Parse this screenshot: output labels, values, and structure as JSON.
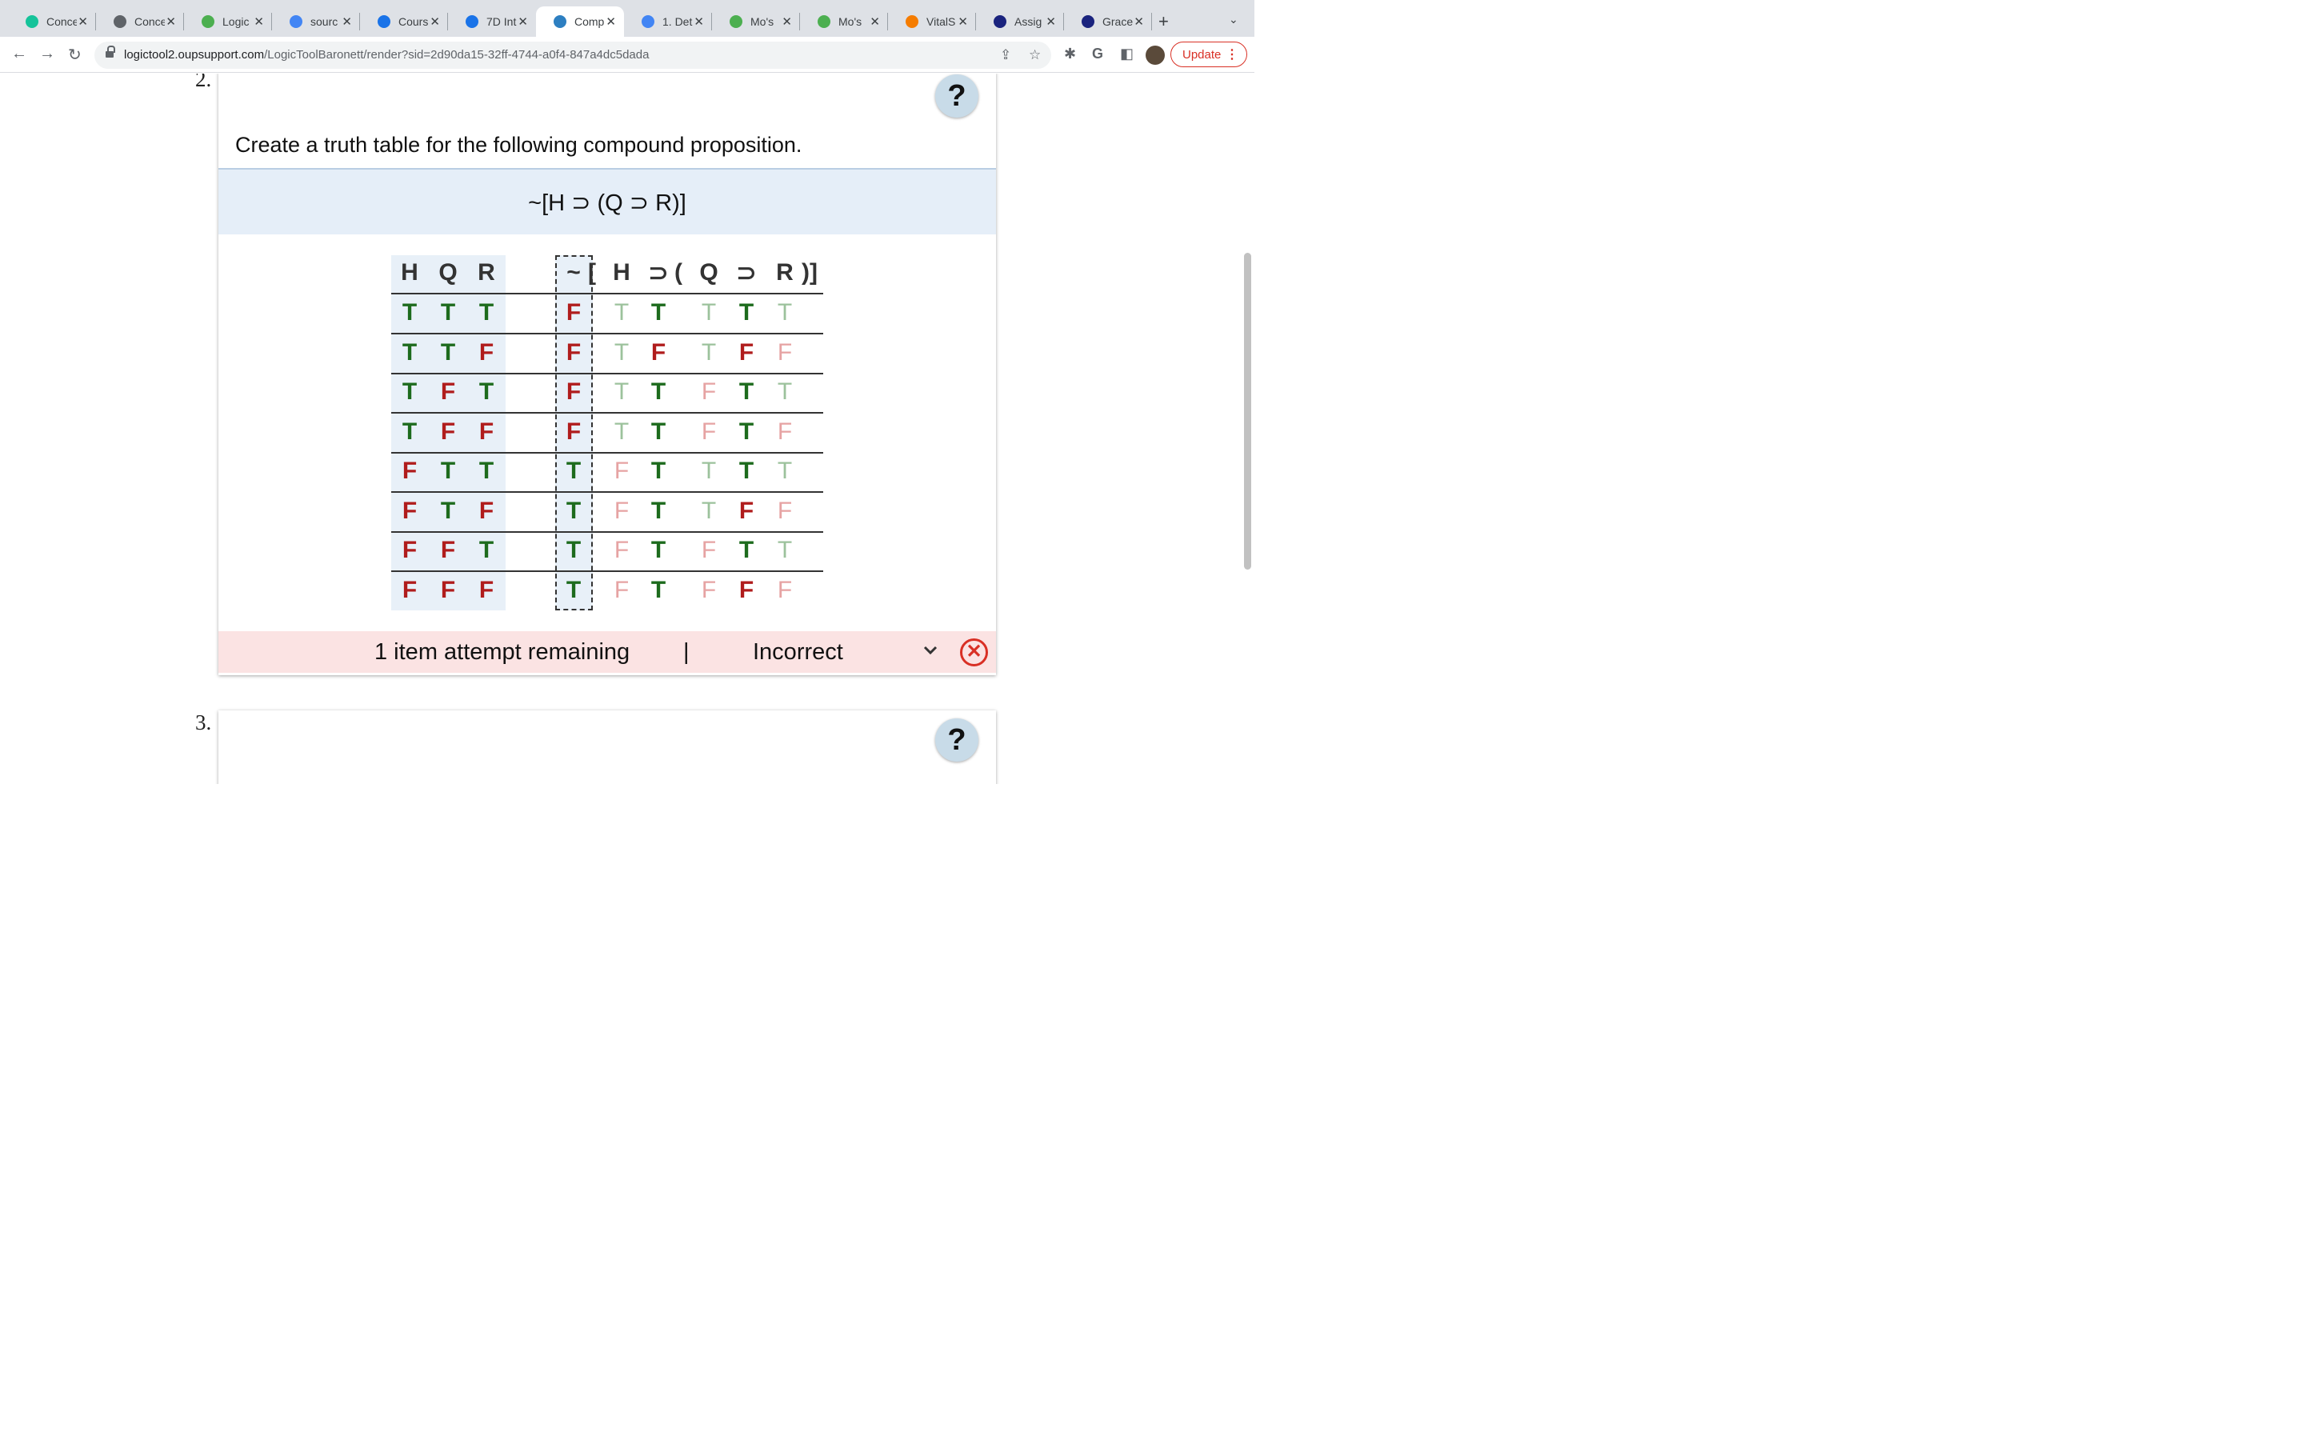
{
  "browser": {
    "tabs": [
      {
        "label": "Conce",
        "icon": "grammarly-icon",
        "color": "#15c39a"
      },
      {
        "label": "Conce",
        "icon": "globe-icon",
        "color": "#5f6368"
      },
      {
        "label": "Logic",
        "icon": "asterisk-icon",
        "color": "#4caf50"
      },
      {
        "label": "sourc",
        "icon": "docs-icon",
        "color": "#4285f4"
      },
      {
        "label": "Cours",
        "icon": "circle-icon",
        "color": "#1a73e8"
      },
      {
        "label": "7D Int",
        "icon": "circle-icon",
        "color": "#1a73e8"
      },
      {
        "label": "Comp",
        "icon": "oup-logic-icon",
        "color": "#2d7fc1"
      },
      {
        "label": "1. Det",
        "icon": "google-icon",
        "color": "#4285f4"
      },
      {
        "label": "Mo's",
        "icon": "asterisk-icon",
        "color": "#4caf50"
      },
      {
        "label": "Mo's",
        "icon": "asterisk-icon",
        "color": "#4caf50"
      },
      {
        "label": "VitalS",
        "icon": "vitalsource-icon",
        "color": "#f57c00"
      },
      {
        "label": "Assig",
        "icon": "bookmark-icon",
        "color": "#1a237e"
      },
      {
        "label": "Grace",
        "icon": "bookmark-icon",
        "color": "#1a237e"
      }
    ],
    "active_tab_index": 6,
    "url_host": "logictool2.oupsupport.com",
    "url_path": "/LogicToolBaronett/render?sid=2d90da15-32ff-4744-a0f4-847a4dc5dada",
    "update_label": "Update"
  },
  "question2": {
    "number": "2.",
    "help_label": "?",
    "prompt": "Create a truth table for the following compound proposition.",
    "proposition": "~[H ⊃ (Q ⊃ R)]",
    "ref_headers": [
      "H",
      "Q",
      "R"
    ],
    "main_headers": [
      "~",
      "[",
      "H",
      "⊃",
      "(",
      "Q",
      "⊃",
      "R",
      ")]"
    ],
    "rows": [
      {
        "ref": [
          "T",
          "T",
          "T"
        ],
        "main": "F",
        "cols": [
          "T",
          "T",
          "T",
          "T",
          "T"
        ]
      },
      {
        "ref": [
          "T",
          "T",
          "F"
        ],
        "main": "F",
        "cols": [
          "T",
          "F",
          "T",
          "F",
          "F"
        ]
      },
      {
        "ref": [
          "T",
          "F",
          "T"
        ],
        "main": "F",
        "cols": [
          "T",
          "T",
          "F",
          "T",
          "T"
        ]
      },
      {
        "ref": [
          "T",
          "F",
          "F"
        ],
        "main": "F",
        "cols": [
          "T",
          "T",
          "F",
          "T",
          "F"
        ]
      },
      {
        "ref": [
          "F",
          "T",
          "T"
        ],
        "main": "T",
        "cols": [
          "F",
          "T",
          "T",
          "T",
          "T"
        ]
      },
      {
        "ref": [
          "F",
          "T",
          "F"
        ],
        "main": "T",
        "cols": [
          "F",
          "T",
          "T",
          "F",
          "F"
        ]
      },
      {
        "ref": [
          "F",
          "F",
          "T"
        ],
        "main": "T",
        "cols": [
          "F",
          "T",
          "F",
          "T",
          "T"
        ]
      },
      {
        "ref": [
          "F",
          "F",
          "F"
        ],
        "main": "T",
        "cols": [
          "F",
          "T",
          "F",
          "F",
          "F"
        ]
      }
    ],
    "status": {
      "attempts": "1 item attempt remaining",
      "separator": "|",
      "result": "Incorrect"
    }
  },
  "question3": {
    "number": "3.",
    "help_label": "?"
  }
}
